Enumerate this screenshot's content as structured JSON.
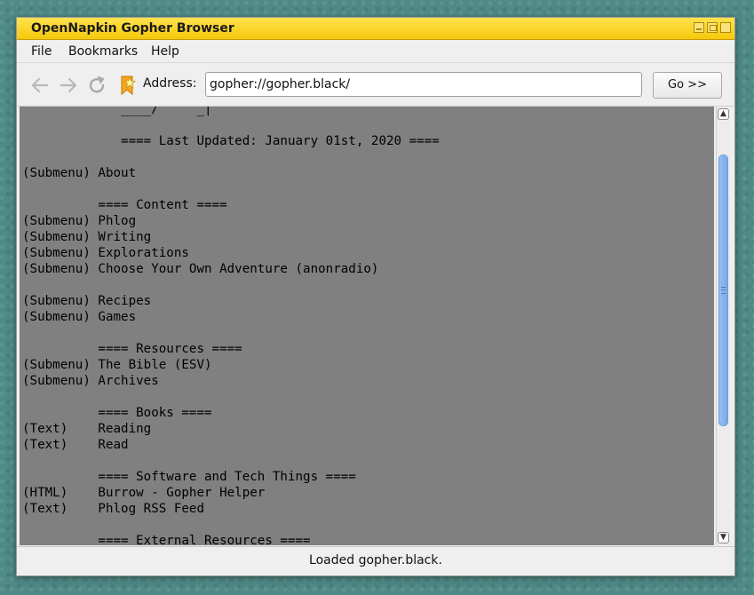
{
  "window": {
    "title": "OpenNapkin Gopher Browser"
  },
  "menu": [
    "File",
    "Bookmarks",
    "Help"
  ],
  "toolbar": {
    "address_label": "Address:",
    "address_value": "gopher://gopher.black/",
    "go_label": "Go >>"
  },
  "content": {
    "lines": [
      "             ____/     _|",
      "",
      "             ==== Last Updated: January 01st, 2020 ====",
      "",
      "(Submenu) About",
      "",
      "          ==== Content ====",
      "(Submenu) Phlog",
      "(Submenu) Writing",
      "(Submenu) Explorations",
      "(Submenu) Choose Your Own Adventure (anonradio)",
      "",
      "(Submenu) Recipes",
      "(Submenu) Games",
      "",
      "          ==== Resources ====",
      "(Submenu) The Bible (ESV)",
      "(Submenu) Archives",
      "",
      "          ==== Books ====",
      "(Text)    Reading",
      "(Text)    Read",
      "",
      "          ==== Software and Tech Things ====",
      "(HTML)    Burrow - Gopher Helper",
      "(Text)    Phlog RSS Feed",
      "",
      "          ==== External Resources ===="
    ]
  },
  "status": "Loaded gopher.black.",
  "colors": {
    "titlebar": "#f7cc17",
    "content_bg": "#808080",
    "scroll_thumb": "#86b3ea"
  },
  "icons": [
    "back-arrow-icon",
    "forward-arrow-icon",
    "reload-icon",
    "bookmark-star-icon"
  ]
}
